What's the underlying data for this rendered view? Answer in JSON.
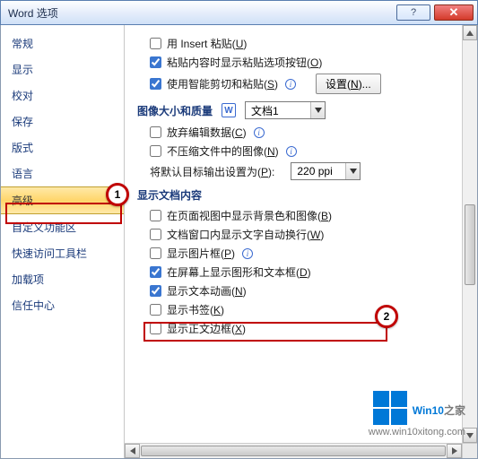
{
  "title": "Word 选项",
  "sidebar": {
    "items": [
      {
        "label": "常规"
      },
      {
        "label": "显示"
      },
      {
        "label": "校对"
      },
      {
        "label": "保存"
      },
      {
        "label": "版式"
      },
      {
        "label": "语言"
      },
      {
        "label": "高级"
      },
      {
        "label": "自定义功能区"
      },
      {
        "label": "快速访问工具栏"
      },
      {
        "label": "加载项"
      },
      {
        "label": "信任中心"
      }
    ]
  },
  "opts": {
    "insertPaste_pre": "用 Insert 粘贴(",
    "insertPaste_u": "U",
    "insertPaste_post": ")",
    "pasteOptBtn_pre": "粘贴内容时显示粘贴选项按钮(",
    "pasteOptBtn_u": "O",
    "pasteOptBtn_post": ")",
    "smartCut_pre": "使用智能剪切和粘贴(",
    "smartCut_u": "S",
    "smartCut_post": ")",
    "settings_pre": "设置(",
    "settings_u": "N",
    "settings_post": ")...",
    "discardEdit_pre": "放弃编辑数据(",
    "discardEdit_u": "C",
    "discardEdit_post": ")",
    "noCompress_pre": "不压缩文件中的图像(",
    "noCompress_u": "N",
    "noCompress_post": ")",
    "defaultTarget_pre": "将默认目标输出设置为(",
    "defaultTarget_u": "P",
    "defaultTarget_post": "):",
    "bgPageView_pre": "在页面视图中显示背景色和图像(",
    "bgPageView_u": "B",
    "bgPageView_post": ")",
    "wrapWindow_pre": "文档窗口内显示文字自动换行(",
    "wrapWindow_u": "W",
    "wrapWindow_post": ")",
    "showPicFrame_pre": "显示图片框(",
    "showPicFrame_u": "P",
    "showPicFrame_post": ")",
    "showDrawings_pre": "在屏幕上显示图形和文本框(",
    "showDrawings_u": "D",
    "showDrawings_post": ")",
    "textAnim_pre": "显示文本动画(",
    "textAnim_u": "N",
    "textAnim_post": ")",
    "bookmarks_pre": "显示书签(",
    "bookmarks_u": "K",
    "bookmarks_post": ")",
    "textBound_pre": "显示正文边框(",
    "textBound_u": "X",
    "textBound_post": ")"
  },
  "sections": {
    "imageSize": "图像大小和质量",
    "docContent": "显示文档内容"
  },
  "dropdowns": {
    "doc": "文档1",
    "ppi": "220 ppi"
  },
  "annotations": {
    "a1": "1",
    "a2": "2"
  },
  "watermark": {
    "brand_a": "Win10",
    "brand_b": "之家",
    "url": "www.win10xitong.com"
  }
}
